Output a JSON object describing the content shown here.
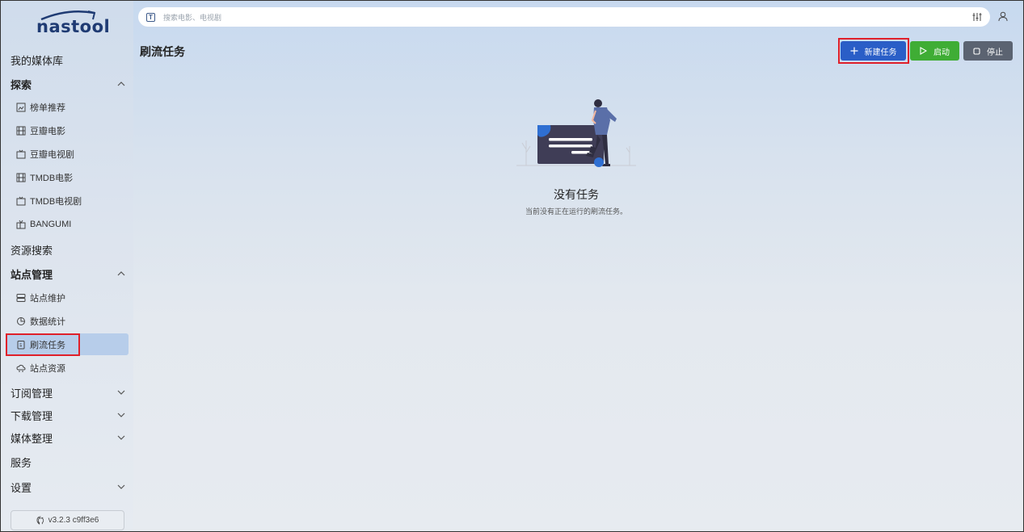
{
  "app": {
    "logo_text": "nastool",
    "version": "v3.2.3 c9ff3e6"
  },
  "sidebar": {
    "my_media": "我的媒体库",
    "explore": {
      "label": "探索",
      "items": [
        "榜单推荐",
        "豆瓣电影",
        "豆瓣电视剧",
        "TMDB电影",
        "TMDB电视剧",
        "BANGUMI"
      ]
    },
    "resource_search": "资源搜索",
    "site_management": {
      "label": "站点管理",
      "items": [
        "站点维护",
        "数据统计",
        "刷流任务",
        "站点资源"
      ]
    },
    "subscription": "订阅管理",
    "download": "下载管理",
    "media_organize": "媒体整理",
    "services": "服务",
    "settings": "设置"
  },
  "search": {
    "placeholder": "搜索电影、电视剧"
  },
  "page": {
    "title": "刷流任务",
    "new_task_label": "新建任务",
    "start_label": "启动",
    "stop_label": "停止",
    "empty_title": "没有任务",
    "empty_desc": "当前没有正在运行的刷流任务。"
  },
  "colors": {
    "primary": "#2a5ec7",
    "success": "#3fad35",
    "secondary": "#5b6371",
    "highlight": "#e0202a",
    "active_nav": "#b7cdea"
  }
}
